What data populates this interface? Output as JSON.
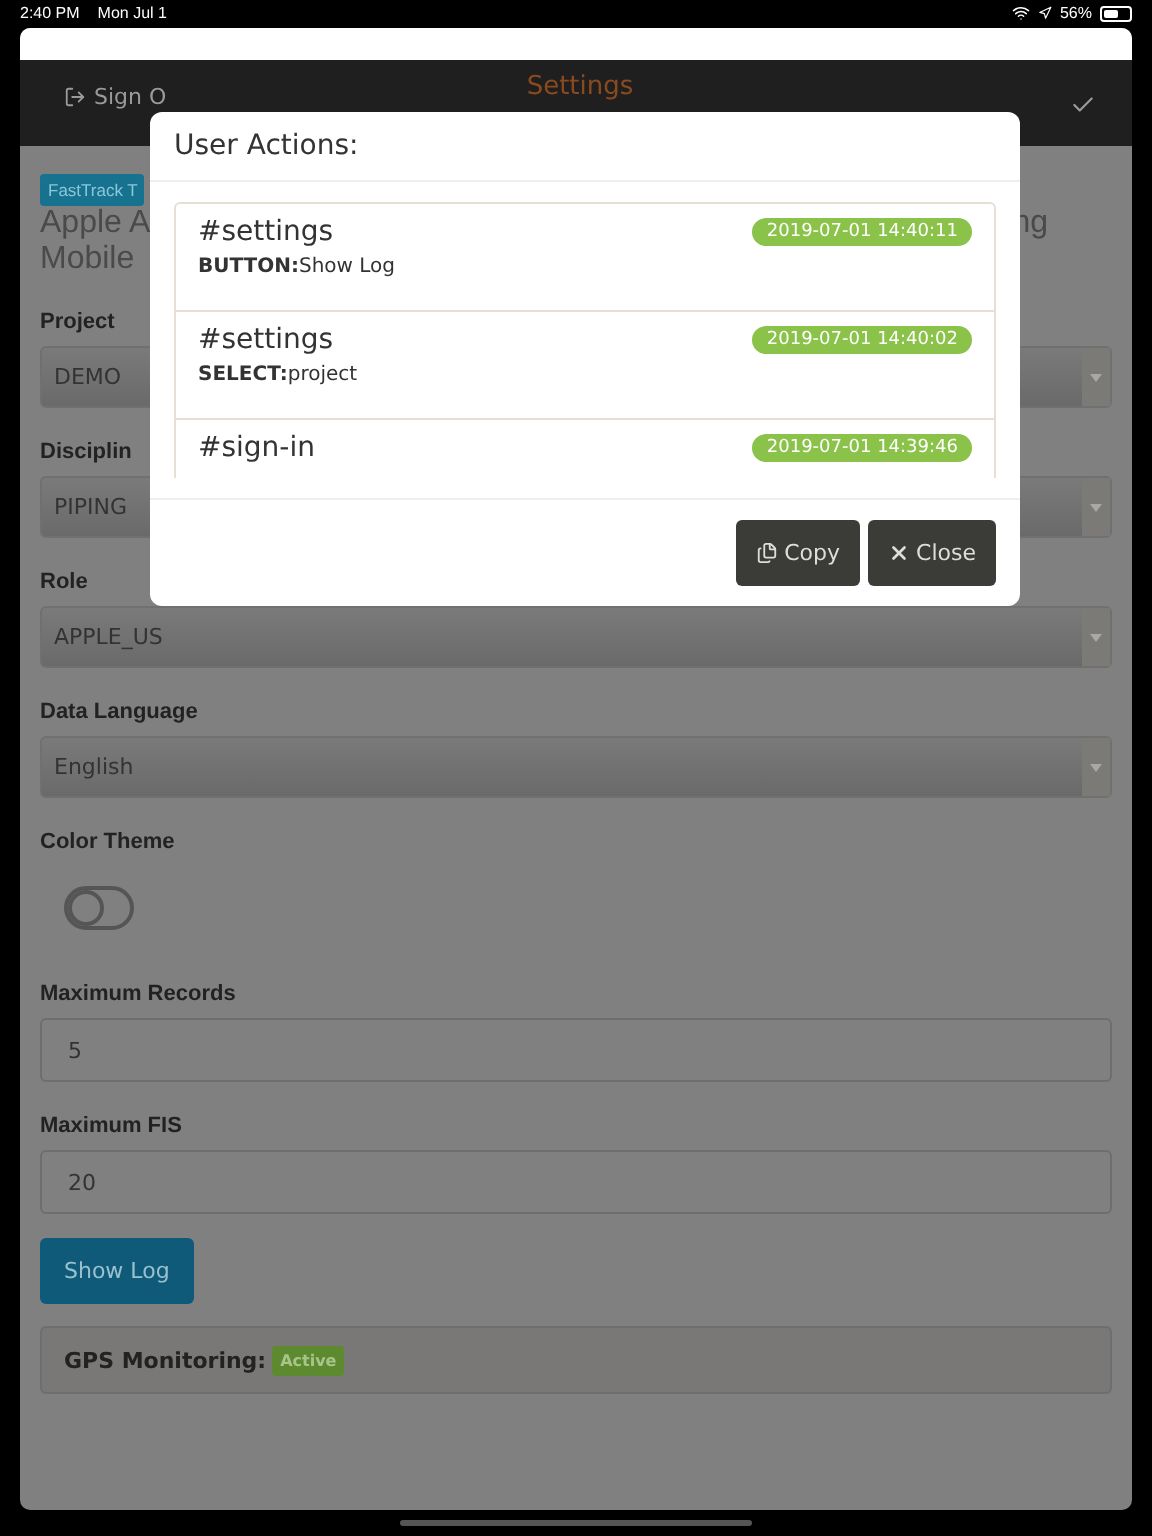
{
  "status_bar": {
    "time": "2:40 PM",
    "date": "Mon Jul 1",
    "battery": "56%"
  },
  "header": {
    "left": "Sign O",
    "title": "Settings"
  },
  "app_badge": "FastTrack T",
  "app_title": {
    "left": "Apple A",
    "right": "ng",
    "line2": "Mobile"
  },
  "fields": [
    {
      "kind": "select",
      "label": "Project",
      "value": "DEMO"
    },
    {
      "kind": "select",
      "label": "Disciplin",
      "value": "PIPING"
    },
    {
      "kind": "select",
      "label": "Role",
      "value": "APPLE_US"
    },
    {
      "kind": "select",
      "label": "Data Language",
      "value": "English"
    },
    {
      "kind": "toggle",
      "label": "Color Theme",
      "on": false
    },
    {
      "kind": "input",
      "label": "Maximum Records",
      "value": "5"
    },
    {
      "kind": "input",
      "label": "Maximum FIS",
      "value": "20"
    }
  ],
  "show_log_button": "Show Log",
  "gps": {
    "label": "GPS Monitoring:",
    "badge": "Active"
  },
  "modal": {
    "title": "User Actions:",
    "entries": [
      {
        "tag": "#settings",
        "time": "2019-07-01 14:40:11",
        "detail": "**BUTTON:**Show Log"
      },
      {
        "tag": "#settings",
        "time": "2019-07-01 14:40:02",
        "detail": "**SELECT:**project"
      },
      {
        "tag": "#sign-in",
        "time": "2019-07-01 14:39:46"
      }
    ],
    "buttons": [
      {
        "kind": "copy",
        "label": "Copy"
      },
      {
        "kind": "close",
        "label": "Close"
      }
    ]
  }
}
